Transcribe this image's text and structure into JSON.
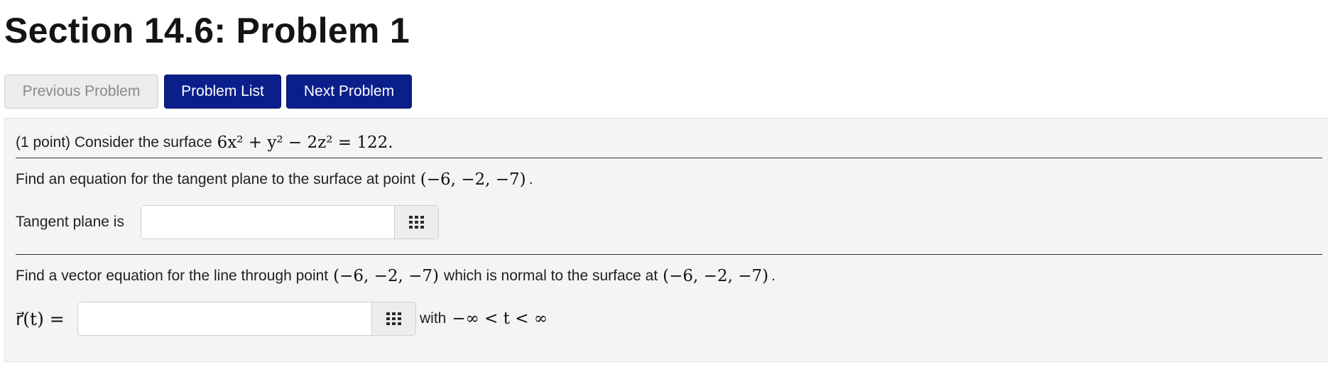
{
  "header": {
    "title": "Section 14.6: Problem 1"
  },
  "nav": {
    "previous_label": "Previous Problem",
    "list_label": "Problem List",
    "next_label": "Next Problem"
  },
  "problem": {
    "intro_text": "(1 point) Consider the surface",
    "surface_equation": "6x² + y² − 2z² = 122.",
    "part1": {
      "prompt": "Find an equation for the tangent plane to the surface at point",
      "point": "(−6, −2, −7)",
      "end": ".",
      "answer_label": "Tangent plane is",
      "answer_value": ""
    },
    "part2": {
      "prompt": "Find a vector equation for the line through point",
      "point": "(−6, −2, −7)",
      "mid_text": "which is normal to the surface at",
      "point2": "(−6, −2, −7)",
      "end": ".",
      "answer_label": "r⃗(t) =",
      "answer_value": "",
      "with_text": "with",
      "range": "−∞ < t < ∞"
    },
    "equation_editor_icon": "grid-icon"
  }
}
